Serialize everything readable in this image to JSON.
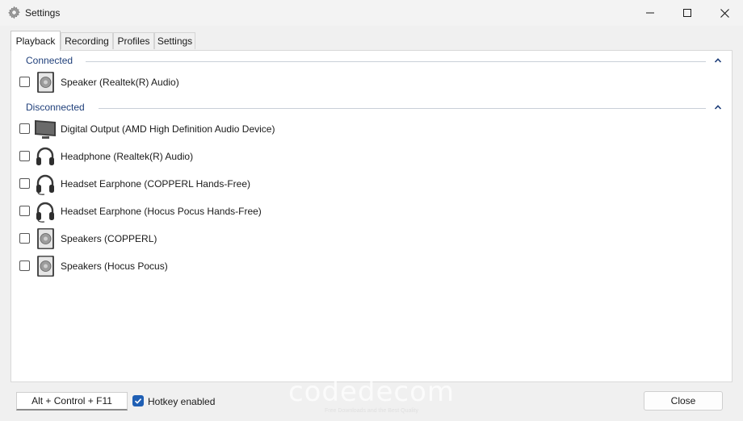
{
  "window": {
    "title": "Settings",
    "icon": "gear-icon",
    "controls": [
      "minimize-icon",
      "maximize-icon",
      "close-icon"
    ]
  },
  "tabs": [
    {
      "label": "Playback",
      "active": true
    },
    {
      "label": "Recording",
      "active": false
    },
    {
      "label": "Profiles",
      "active": false
    },
    {
      "label": "Settings",
      "active": false
    }
  ],
  "sections": [
    {
      "title": "Connected",
      "collapsed": false,
      "devices": [
        {
          "label": "Speaker (Realtek(R) Audio)",
          "icon": "speaker-icon",
          "checked": false
        }
      ]
    },
    {
      "title": "Disconnected",
      "collapsed": false,
      "devices": [
        {
          "label": "Digital Output (AMD High Definition Audio Device)",
          "icon": "monitor-icon",
          "checked": false
        },
        {
          "label": "Headphone (Realtek(R) Audio)",
          "icon": "headphone-icon",
          "checked": false
        },
        {
          "label": "Headset Earphone (COPPERL Hands-Free)",
          "icon": "headset-icon",
          "checked": false
        },
        {
          "label": "Headset Earphone (Hocus Pocus Hands-Free)",
          "icon": "headset-icon",
          "checked": false
        },
        {
          "label": "Speakers (COPPERL)",
          "icon": "speaker-icon",
          "checked": false
        },
        {
          "label": "Speakers (Hocus Pocus)",
          "icon": "speaker-icon",
          "checked": false
        }
      ]
    }
  ],
  "footer": {
    "hotkey_value": "Alt + Control + F11",
    "hotkey_enabled_label": "Hotkey enabled",
    "hotkey_enabled": true,
    "close_label": "Close"
  },
  "watermark": {
    "text": "codedecom",
    "subtext": "Free Downloads and the Best Quality"
  },
  "colors": {
    "section_title": "#1f3f7a",
    "checkbox_checked": "#1f5fb4"
  }
}
